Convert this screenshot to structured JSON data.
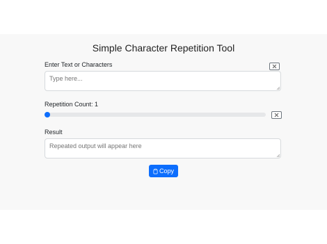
{
  "app": {
    "title": "Simple Character Repetition Tool"
  },
  "input": {
    "label": "Enter Text or Characters",
    "placeholder": "Type here...",
    "value": ""
  },
  "repetition": {
    "label": "Repetition Count: 1",
    "count": 1,
    "min": 1,
    "max": 100
  },
  "result": {
    "label": "Result",
    "placeholder": "Repeated output will appear here",
    "value": ""
  },
  "actions": {
    "copy_label": "Copy"
  },
  "icons": {
    "clear_input": "close-icon",
    "clear_count": "close-icon",
    "copy": "clipboard-icon"
  },
  "colors": {
    "accent": "#0d6efd",
    "background": "#f8f8f8"
  }
}
